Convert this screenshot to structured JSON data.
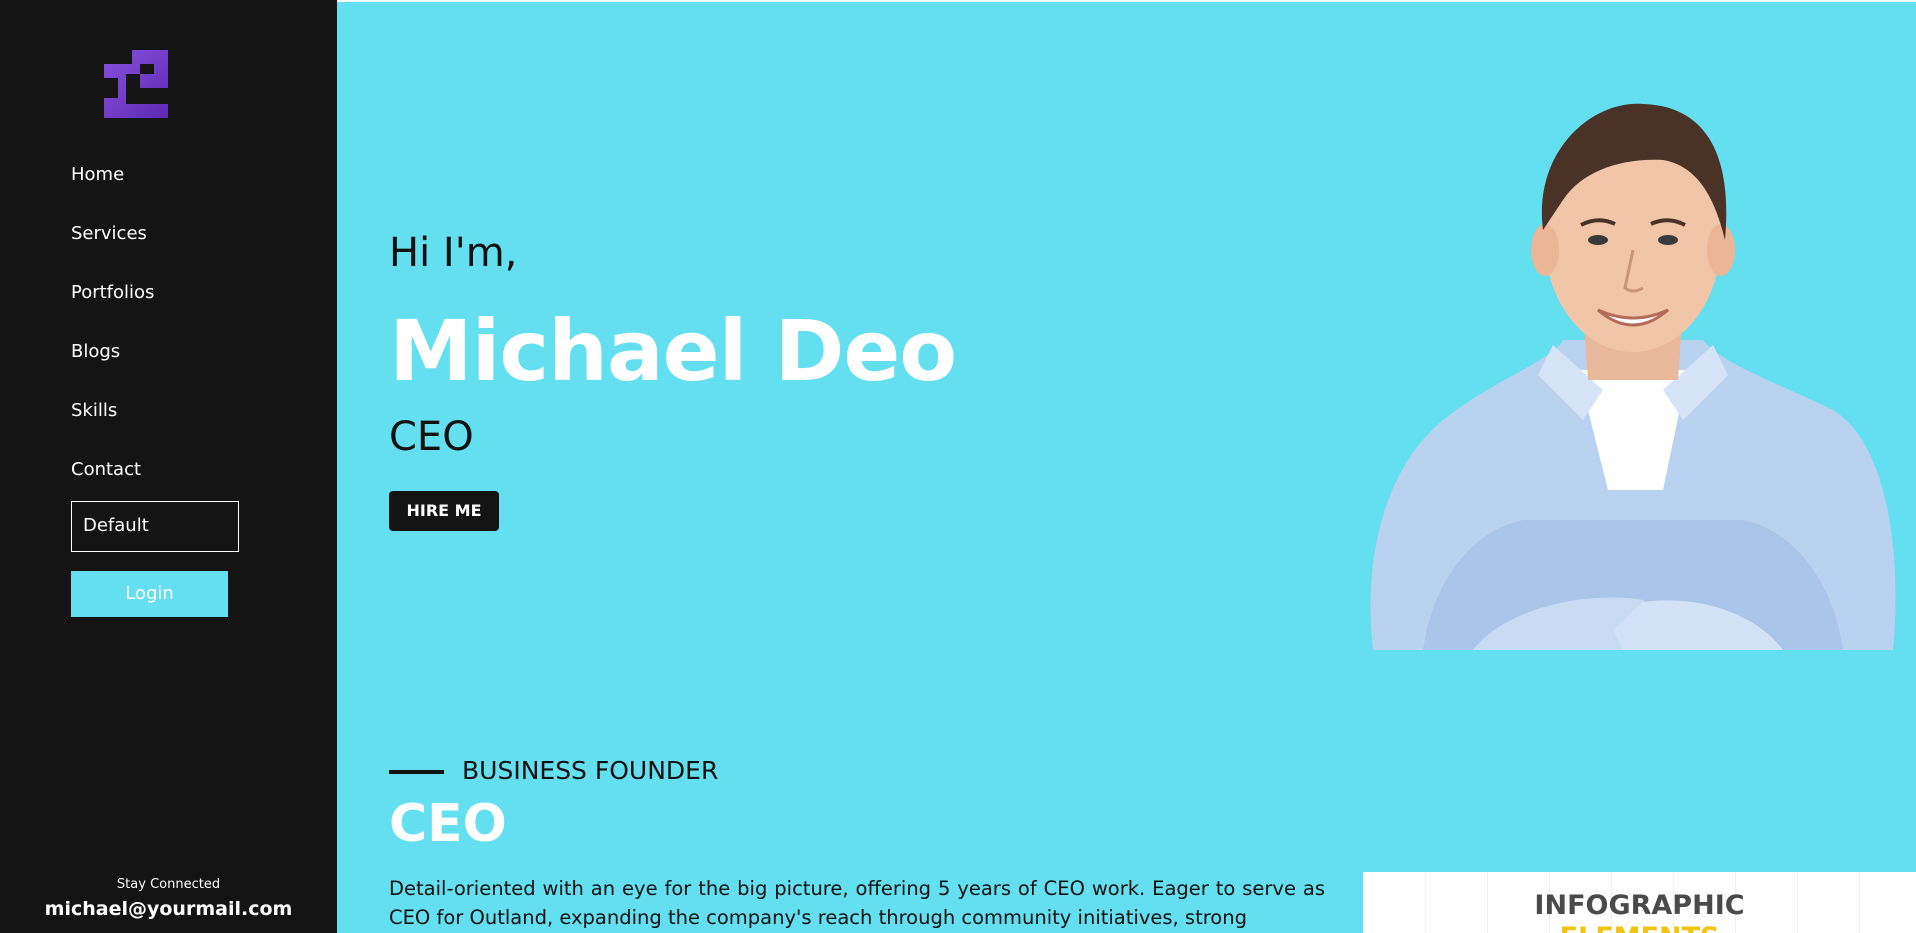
{
  "sidebar": {
    "logo": "stylized-letter-logo",
    "nav": [
      {
        "label": "Home"
      },
      {
        "label": "Services"
      },
      {
        "label": "Portfolios"
      },
      {
        "label": "Blogs"
      },
      {
        "label": "Skills"
      },
      {
        "label": "Contact"
      }
    ],
    "theme_select_value": "Default",
    "login_label": "Login",
    "stay_connected": "Stay Connected",
    "email": "michael@yourmail.com"
  },
  "hero": {
    "greeting": "Hi I'm,",
    "name": "Michael Deo",
    "role": "CEO",
    "hire_label": "HIRE ME",
    "portrait": "smiling-man-portrait"
  },
  "about": {
    "kicker": "BUSINESS FOUNDER",
    "heading": "CEO",
    "bio": "Detail-oriented with an eye for the big picture, offering 5 years of CEO work. Eager to serve as CEO for Outland, expanding the company's reach through community initiatives, strong"
  },
  "infographic": {
    "title": "INFOGRAPHIC",
    "subtitle": "ELEMENTS"
  },
  "colors": {
    "accent": "#63dff0",
    "sidebar_bg": "#141414",
    "logo_purple": "#7b3fd1"
  }
}
